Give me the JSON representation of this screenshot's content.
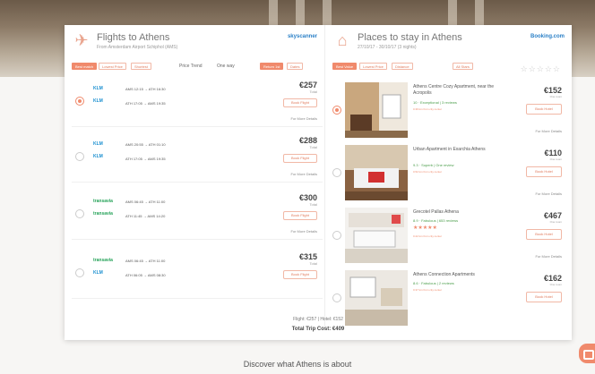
{
  "flights": {
    "title": "Flights to Athens",
    "subtitle": "From Amsterdam Airport Schiphol (AMS)",
    "brand": "skyscanner",
    "filters": [
      "Best match",
      "Lowest Price",
      "Shortest"
    ],
    "price_trend": "Price Trend",
    "one_way": "One way",
    "small_filters": [
      "Return 1st",
      "Dates"
    ],
    "rows": [
      {
        "airline": "KLM",
        "out": "AMS 12:15 → ATH 16:30",
        "ret": "ATH 17:05 → AMS 19:35",
        "price": "€257",
        "total": "Total",
        "book": "Book Flight",
        "details": "For More Details",
        "selected": true
      },
      {
        "airline": "KLM",
        "out": "AMS 20:55 → ATH 01:10",
        "ret": "ATH 17:05 → AMS 19:35",
        "price": "€288",
        "total": "Total",
        "book": "Book Flight",
        "details": "For More Details",
        "selected": false
      },
      {
        "airline": "transavia",
        "out": "AMS 06:45 → ATH 11:00",
        "ret": "ATH 11:45 → AMS 14:20",
        "price": "€300",
        "total": "Total",
        "book": "Book Flight",
        "details": "For More Details",
        "selected": false
      },
      {
        "airline": "transavia",
        "out": "AMS 06:45 → ATH 11:00",
        "ret": "ATH 06:05 → AMS 08:30",
        "price": "€315",
        "total": "Total",
        "book": "Book Flight",
        "details": "For More Details",
        "selected": false
      }
    ]
  },
  "hotels": {
    "title": "Places to stay in Athens",
    "subtitle": "27/10/17 - 30/10/17 (3 nights)",
    "brand": "Booking.com",
    "filters": [
      "Best Value",
      "Lowest Price",
      "Distance"
    ],
    "all_stars": "All Stars",
    "stars": "☆☆☆☆☆",
    "rows": [
      {
        "name": "Athens Centre Cozy Apartment, near the Acropolis",
        "rating": "10 · Exceptional | 3 reviews",
        "dist": "0.39 km from city center",
        "price": "€152",
        "per": "One room",
        "book": "Book Hotel",
        "details": "For More Details",
        "selected": true
      },
      {
        "name": "Urban Apartment in Exarchia Athens",
        "rating": "9.3 · Superb | One review",
        "dist": "0.52 km from city center",
        "price": "€110",
        "per": "One room",
        "book": "Book Hotel",
        "details": "For More Details",
        "selected": false
      },
      {
        "name": "Grecotel Pallas Athena",
        "rating": "8.9 · Fabulous | 653 reviews",
        "dist": "0.22 km from city center",
        "price": "€467",
        "per": "One room",
        "book": "Book Hotel",
        "details": "For More Details",
        "selected": false,
        "stars": "★★★★★"
      },
      {
        "name": "Athens Connection Apartments",
        "rating": "8.6 · Fabulous | 2 reviews",
        "dist": "0.37 km from city center",
        "price": "€162",
        "per": "One room",
        "book": "Book Hotel",
        "details": "For More Details",
        "selected": false
      }
    ]
  },
  "summary": {
    "line1": "Flight: €257 | Hotel: €152",
    "total": "Total Trip Cost: €409"
  },
  "discover": "Discover what Athens is about",
  "colors": {
    "accent": "#f08a6c",
    "klm": "#1a8fd0",
    "transavia": "#27a35a"
  }
}
